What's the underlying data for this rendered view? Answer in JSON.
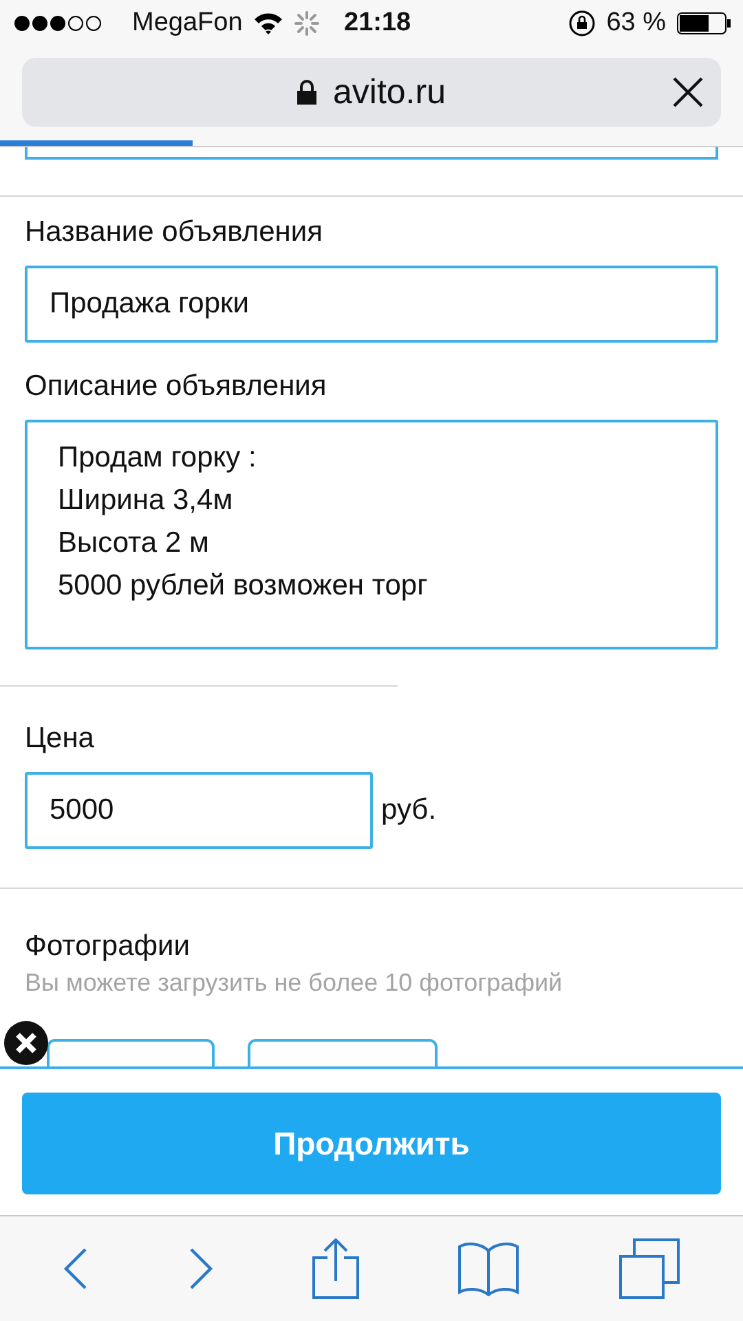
{
  "status_bar": {
    "carrier": "MegaFon",
    "time": "21:18",
    "battery": "63 %"
  },
  "address_bar": {
    "url": "avito.ru",
    "loading": {
      "level": 0.26
    }
  },
  "form": {
    "fields": [
      {
        "kind": "input",
        "label": "Название объявления",
        "value": "Продажа горки"
      },
      {
        "kind": "textarea",
        "label": "Описание объявления",
        "value": "Продам горку :\nШирина 3,4м\nВысота 2 м\n5000 рублей возможен торг"
      },
      {
        "kind": "price",
        "label": "Цена",
        "value": "5000",
        "unit": "руб."
      },
      {
        "kind": "photos",
        "label": "Фотографии",
        "hint": "Вы можете загрузить не более 10 фотографий"
      }
    ]
  },
  "continue_button": "Продолжить"
}
